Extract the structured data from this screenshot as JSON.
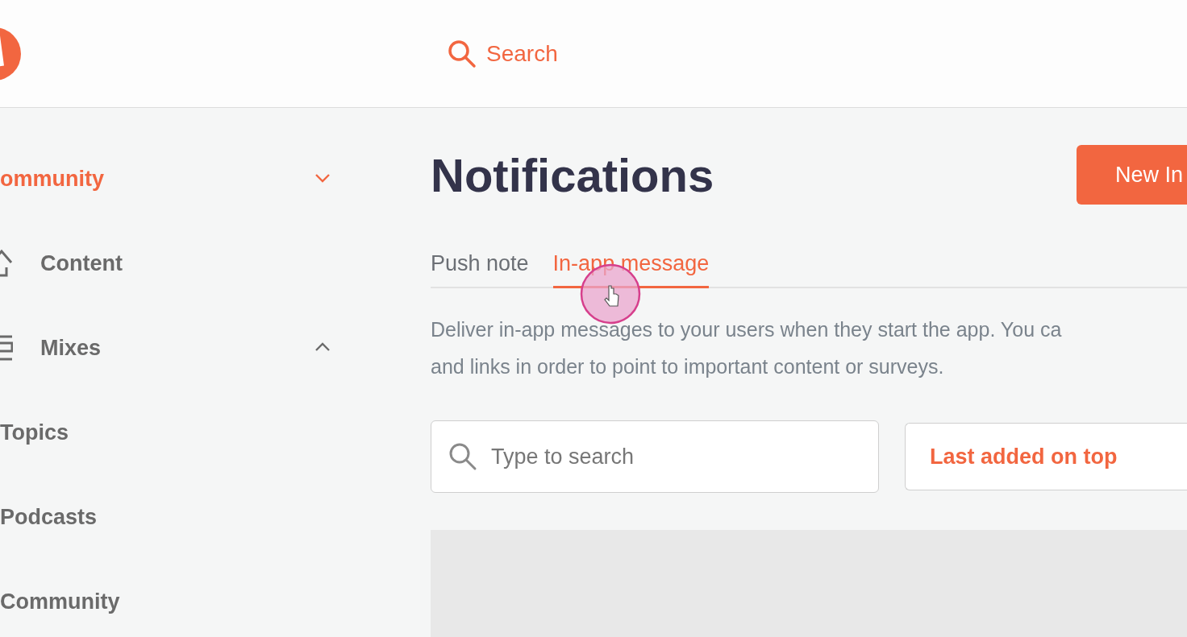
{
  "header": {
    "search_label": "Search"
  },
  "sidebar": {
    "workspace": {
      "label": "ommunity",
      "expanded": false
    },
    "items": [
      {
        "label": "Content",
        "kind": "home"
      },
      {
        "label": "Mixes",
        "kind": "stack",
        "expanded": true
      },
      {
        "label": "Topics",
        "kind": "sub"
      },
      {
        "label": "Podcasts",
        "kind": "sub"
      },
      {
        "label": "Community",
        "kind": "sub"
      }
    ]
  },
  "page": {
    "title": "Notifications",
    "primary_button": "New In",
    "tabs": [
      {
        "label": "Push note",
        "selected": false
      },
      {
        "label": "In-app message",
        "selected": true
      }
    ],
    "description": [
      "Deliver in-app messages to your users when they start the app. You ca",
      "and links in order to point to important content or surveys."
    ],
    "search": {
      "placeholder": "Type to search"
    },
    "sort": {
      "value": "Last added on top"
    }
  }
}
